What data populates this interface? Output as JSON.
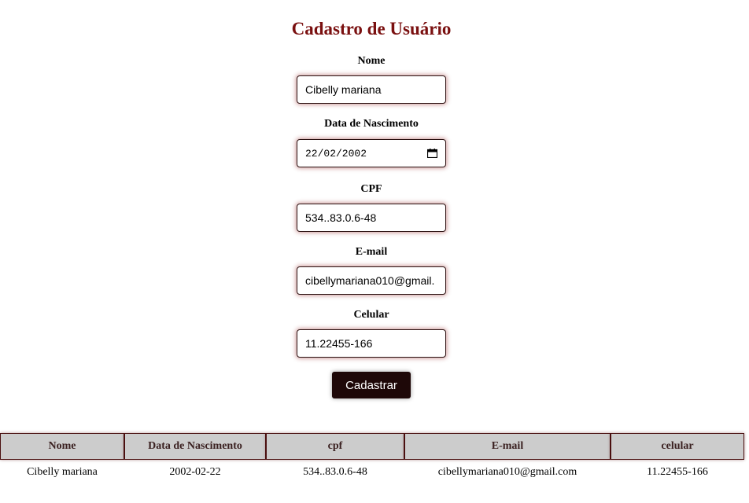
{
  "form": {
    "title": "Cadastro de Usuário",
    "nome": {
      "label": "Nome",
      "value": "Cibelly mariana"
    },
    "nascimento": {
      "label": "Data de Nascimento",
      "value": "22/02/2002"
    },
    "cpf": {
      "label": "CPF",
      "value": "534..83.0.6-48"
    },
    "email": {
      "label": "E-mail",
      "value": "cibellymariana010@gmail."
    },
    "celular": {
      "label": "Celular",
      "value": "11.22455-166"
    },
    "submit_label": "Cadastrar",
    "accent_color": "#7a1010"
  },
  "table": {
    "headers": [
      "Nome",
      "Data de Nascimento",
      "cpf",
      "E-mail",
      "celular"
    ],
    "rows": [
      [
        "Cibelly mariana",
        "2002-02-22",
        "534..83.0.6-48",
        "cibellymariana010@gmail.com",
        "11.22455-166"
      ]
    ]
  }
}
